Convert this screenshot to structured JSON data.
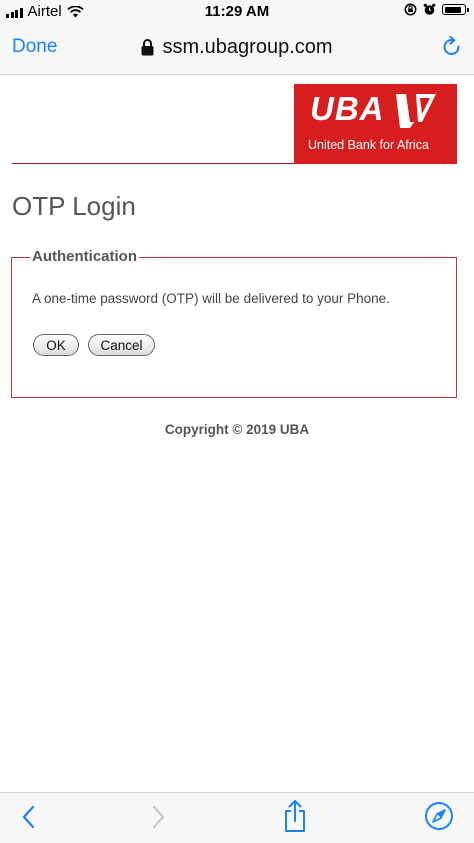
{
  "status_bar": {
    "carrier": "Airtel",
    "time": "11:29 AM",
    "battery_level": 0.9
  },
  "browser": {
    "done_label": "Done",
    "url": "ssm.ubagroup.com",
    "icons": {
      "lock": "lock-icon",
      "reload": "reload-icon",
      "back": "back-arrow-icon",
      "forward": "forward-arrow-icon",
      "share": "share-icon",
      "safari": "compass-icon"
    },
    "accent_color": "#1a82fb"
  },
  "brand": {
    "logo_text": "UBA",
    "tagline": "United Bank for Africa",
    "brand_color": "#d71e1e"
  },
  "page": {
    "title": "OTP Login",
    "section_legend": "Authentication",
    "message": "A one-time password (OTP) will be delivered to your Phone.",
    "ok_label": "OK",
    "cancel_label": "Cancel",
    "copyright": "Copyright © 2019 UBA"
  }
}
